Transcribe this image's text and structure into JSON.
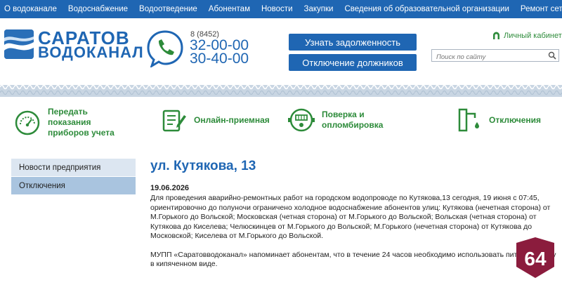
{
  "topnav": {
    "items": [
      "О водоканале",
      "Водоснабжение",
      "Водоотведение",
      "Абонентам",
      "Новости",
      "Закупки",
      "Сведения об образовательной организации",
      "Ремонт сетей"
    ]
  },
  "header": {
    "logo_line1": "САРАТОВ",
    "logo_line2": "ВОДОКАНАЛ",
    "phone_prefix": "8 (8452)",
    "phone1": "32-00-00",
    "phone2": "30-40-00",
    "debt_button": "Узнать задолженность",
    "disconnect_button": "Отключение должников",
    "cabinet_label": "Личный кабинет",
    "search_placeholder": "Поиск по сайту"
  },
  "services": [
    {
      "label": "Передать показания приборов учета",
      "icon": "gauge-icon"
    },
    {
      "label": "Онлайн-приемная",
      "icon": "document-pen-icon"
    },
    {
      "label": "Поверка и опломбировка",
      "icon": "water-meter-icon"
    },
    {
      "label": "Отключения",
      "icon": "faucet-icon"
    }
  ],
  "sidebar": {
    "items": [
      "Новости предприятия",
      "Отключения"
    ]
  },
  "article": {
    "title": "ул. Кутякова, 13",
    "date": "19.06.2026",
    "paragraph1": "Для проведения аварийно-ремонтных работ на городском водопроводе по Кутякова,13 сегодня, 19 июня с 07:45, ориентировочно до полуночи ограничено холодное водоснабжение абонентов улиц: Кутякова (нечетная сторона) от М.Горького до Вольской; Московская (четная сторона) от М.Горького до Вольской; Вольская (четная сторона) от Кутякова до Киселева; Челюскинцев от М.Горького до Вольской; М.Горького (нечетная сторона) от Кутякова до Московской; Киселева от М.Горького до Вольской.",
    "paragraph2": "МУПП «Саратовводоканал» напоминает абонентам, что в течение 24 часов необходимо использовать питьевую воду в кипяченном виде."
  },
  "badge": {
    "text": "64"
  },
  "colors": {
    "brand_blue": "#1f66b3",
    "accent_green": "#2d8b3a",
    "badge_red": "#8b1c3d"
  }
}
